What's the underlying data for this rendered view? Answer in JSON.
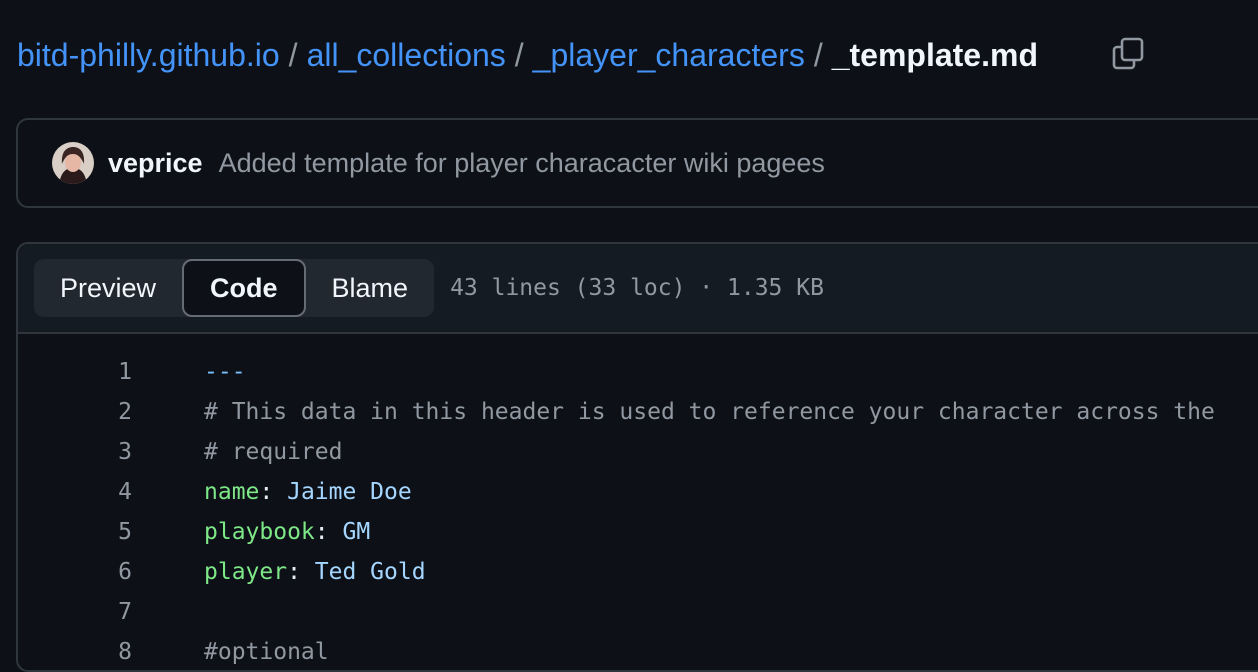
{
  "breadcrumb": {
    "repo": "bitd-philly.github.io",
    "dir1": "all_collections",
    "dir2": "_player_characters",
    "file": "_template.md",
    "separator": "/"
  },
  "commit": {
    "author": "veprice",
    "message": "Added template for player characacter wiki pagees"
  },
  "tabs": {
    "preview": "Preview",
    "code": "Code",
    "blame": "Blame",
    "active": "Code"
  },
  "file_meta": "43 lines (33 loc) · 1.35 KB",
  "code_lines": [
    {
      "n": "1",
      "tokens": [
        {
          "t": "---",
          "c": "punct"
        }
      ]
    },
    {
      "n": "2",
      "tokens": [
        {
          "t": "# This data in this header is used to reference your character across the",
          "c": "comment"
        }
      ]
    },
    {
      "n": "3",
      "tokens": [
        {
          "t": "# required",
          "c": "comment"
        }
      ]
    },
    {
      "n": "4",
      "tokens": [
        {
          "t": "name",
          "c": "key"
        },
        {
          "t": ": ",
          "c": "plain"
        },
        {
          "t": "Jaime Doe",
          "c": "val"
        }
      ]
    },
    {
      "n": "5",
      "tokens": [
        {
          "t": "playbook",
          "c": "key"
        },
        {
          "t": ": ",
          "c": "plain"
        },
        {
          "t": "GM",
          "c": "val"
        }
      ]
    },
    {
      "n": "6",
      "tokens": [
        {
          "t": "player",
          "c": "key"
        },
        {
          "t": ": ",
          "c": "plain"
        },
        {
          "t": "Ted Gold",
          "c": "val"
        }
      ]
    },
    {
      "n": "7",
      "tokens": []
    },
    {
      "n": "8",
      "tokens": [
        {
          "t": "#optional",
          "c": "comment"
        }
      ]
    }
  ],
  "icons": {
    "copy": "copy-icon",
    "avatar": "avatar"
  },
  "colors": {
    "background": "#0d1117",
    "link": "#4493f8",
    "border": "#30363d",
    "yaml_key": "#7ee787",
    "yaml_value": "#a5d6ff",
    "comment": "#9198a1"
  }
}
